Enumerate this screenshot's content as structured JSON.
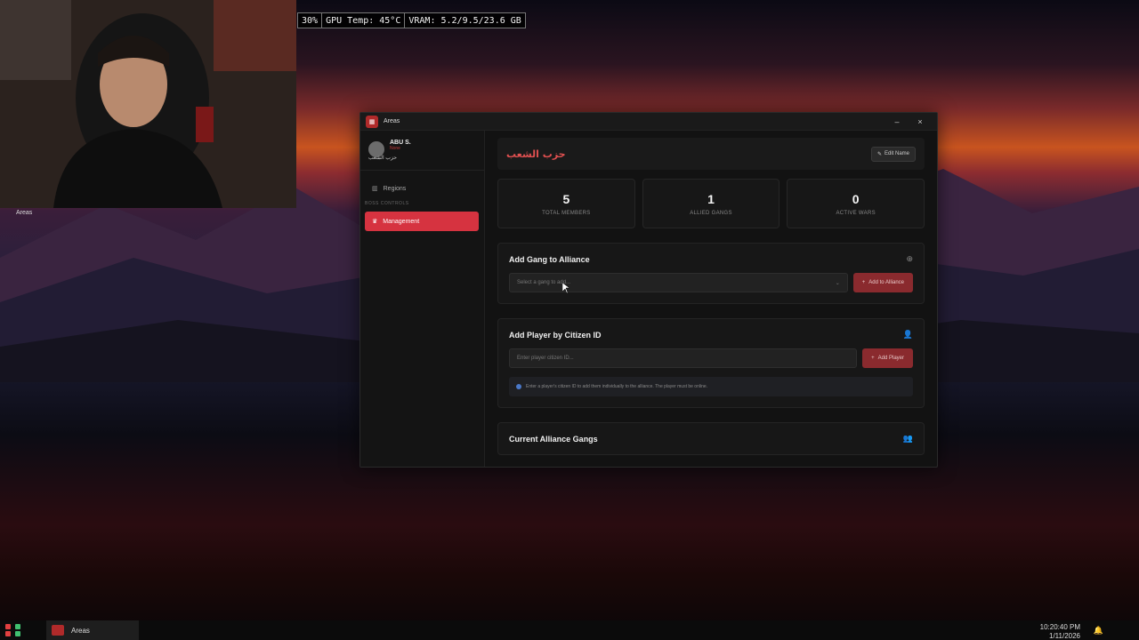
{
  "overlay": {
    "cpu": "30%",
    "gpu_temp": "GPU Temp: 45°C",
    "vram": "VRAM: 5.2/9.5/23.6 GB"
  },
  "webcam": {
    "caption": "Areas"
  },
  "window": {
    "title": "Areas",
    "minimize_glyph": "–",
    "close_glyph": "×"
  },
  "sidebar": {
    "user_name": "ABU S.",
    "user_role": "None",
    "user_gang": "حزب الشعب",
    "items": [
      {
        "label": "Regions",
        "icon": "map-icon"
      }
    ],
    "section_label": "BOSS CONTROLS",
    "active_item": {
      "label": "Management",
      "icon": "crown-icon"
    }
  },
  "header": {
    "gang_name": "حزب الشعب",
    "edit_label": "Edit Name"
  },
  "stats": [
    {
      "value": "5",
      "label": "TOTAL MEMBERS"
    },
    {
      "value": "1",
      "label": "ALLIED GANGS"
    },
    {
      "value": "0",
      "label": "ACTIVE WARS"
    }
  ],
  "add_gang": {
    "title": "Add Gang to Alliance",
    "select_placeholder": "Select a gang to add...",
    "button_label": "Add to Alliance"
  },
  "add_player": {
    "title": "Add Player by Citizen ID",
    "input_placeholder": "Enter player citizen ID...",
    "button_label": "Add Player",
    "info_text": "Enter a player's citizen ID to add them individually to the alliance. The player must be online."
  },
  "current_gangs": {
    "title": "Current Alliance Gangs"
  },
  "taskbar": {
    "app_label": "Areas",
    "time": "10:20:40 PM",
    "date": "1/11/2026"
  },
  "colors": {
    "accent": "#d63340",
    "button_red": "#8a2a2e",
    "gang_name": "#e05050"
  }
}
